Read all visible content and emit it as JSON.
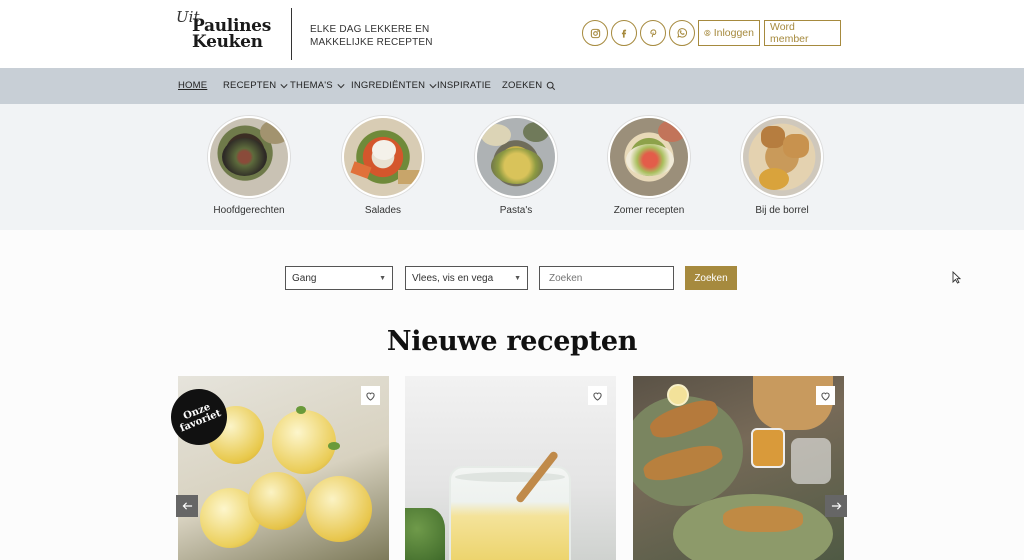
{
  "brand": {
    "script": "Uit",
    "name_line1": "Paulines",
    "name_line2": "Keuken",
    "tagline_line1": "ELKE DAG LEKKERE EN",
    "tagline_line2": "MAKKELIJKE RECEPTEN"
  },
  "header": {
    "social_icons": [
      "instagram-icon",
      "facebook-icon",
      "pinterest-icon",
      "whatsapp-icon"
    ],
    "login_label": "Inloggen",
    "member_label": "Word member",
    "accent_color": "#a68a3e"
  },
  "nav": {
    "items": [
      {
        "label": "HOME"
      },
      {
        "label": "RECEPTEN"
      },
      {
        "label": "THEMA'S"
      },
      {
        "label": "INGREDIËNTEN"
      },
      {
        "label": "INSPIRATIE"
      },
      {
        "label": "ZOEKEN"
      }
    ],
    "background": "#c8cfd6"
  },
  "categories": [
    {
      "label": "Hoofdgerechten"
    },
    {
      "label": "Salades"
    },
    {
      "label": "Pasta's"
    },
    {
      "label": "Zomer recepten"
    },
    {
      "label": "Bij de borrel"
    }
  ],
  "filters": {
    "course_selected": "Gang",
    "type_selected": "Vlees, vis en vega",
    "search_placeholder": "Zoeken",
    "search_button": "Zoeken"
  },
  "new_recipes": {
    "title": "Nieuwe recepten",
    "badge_line1": "Onze",
    "badge_line2": "favoriet"
  }
}
